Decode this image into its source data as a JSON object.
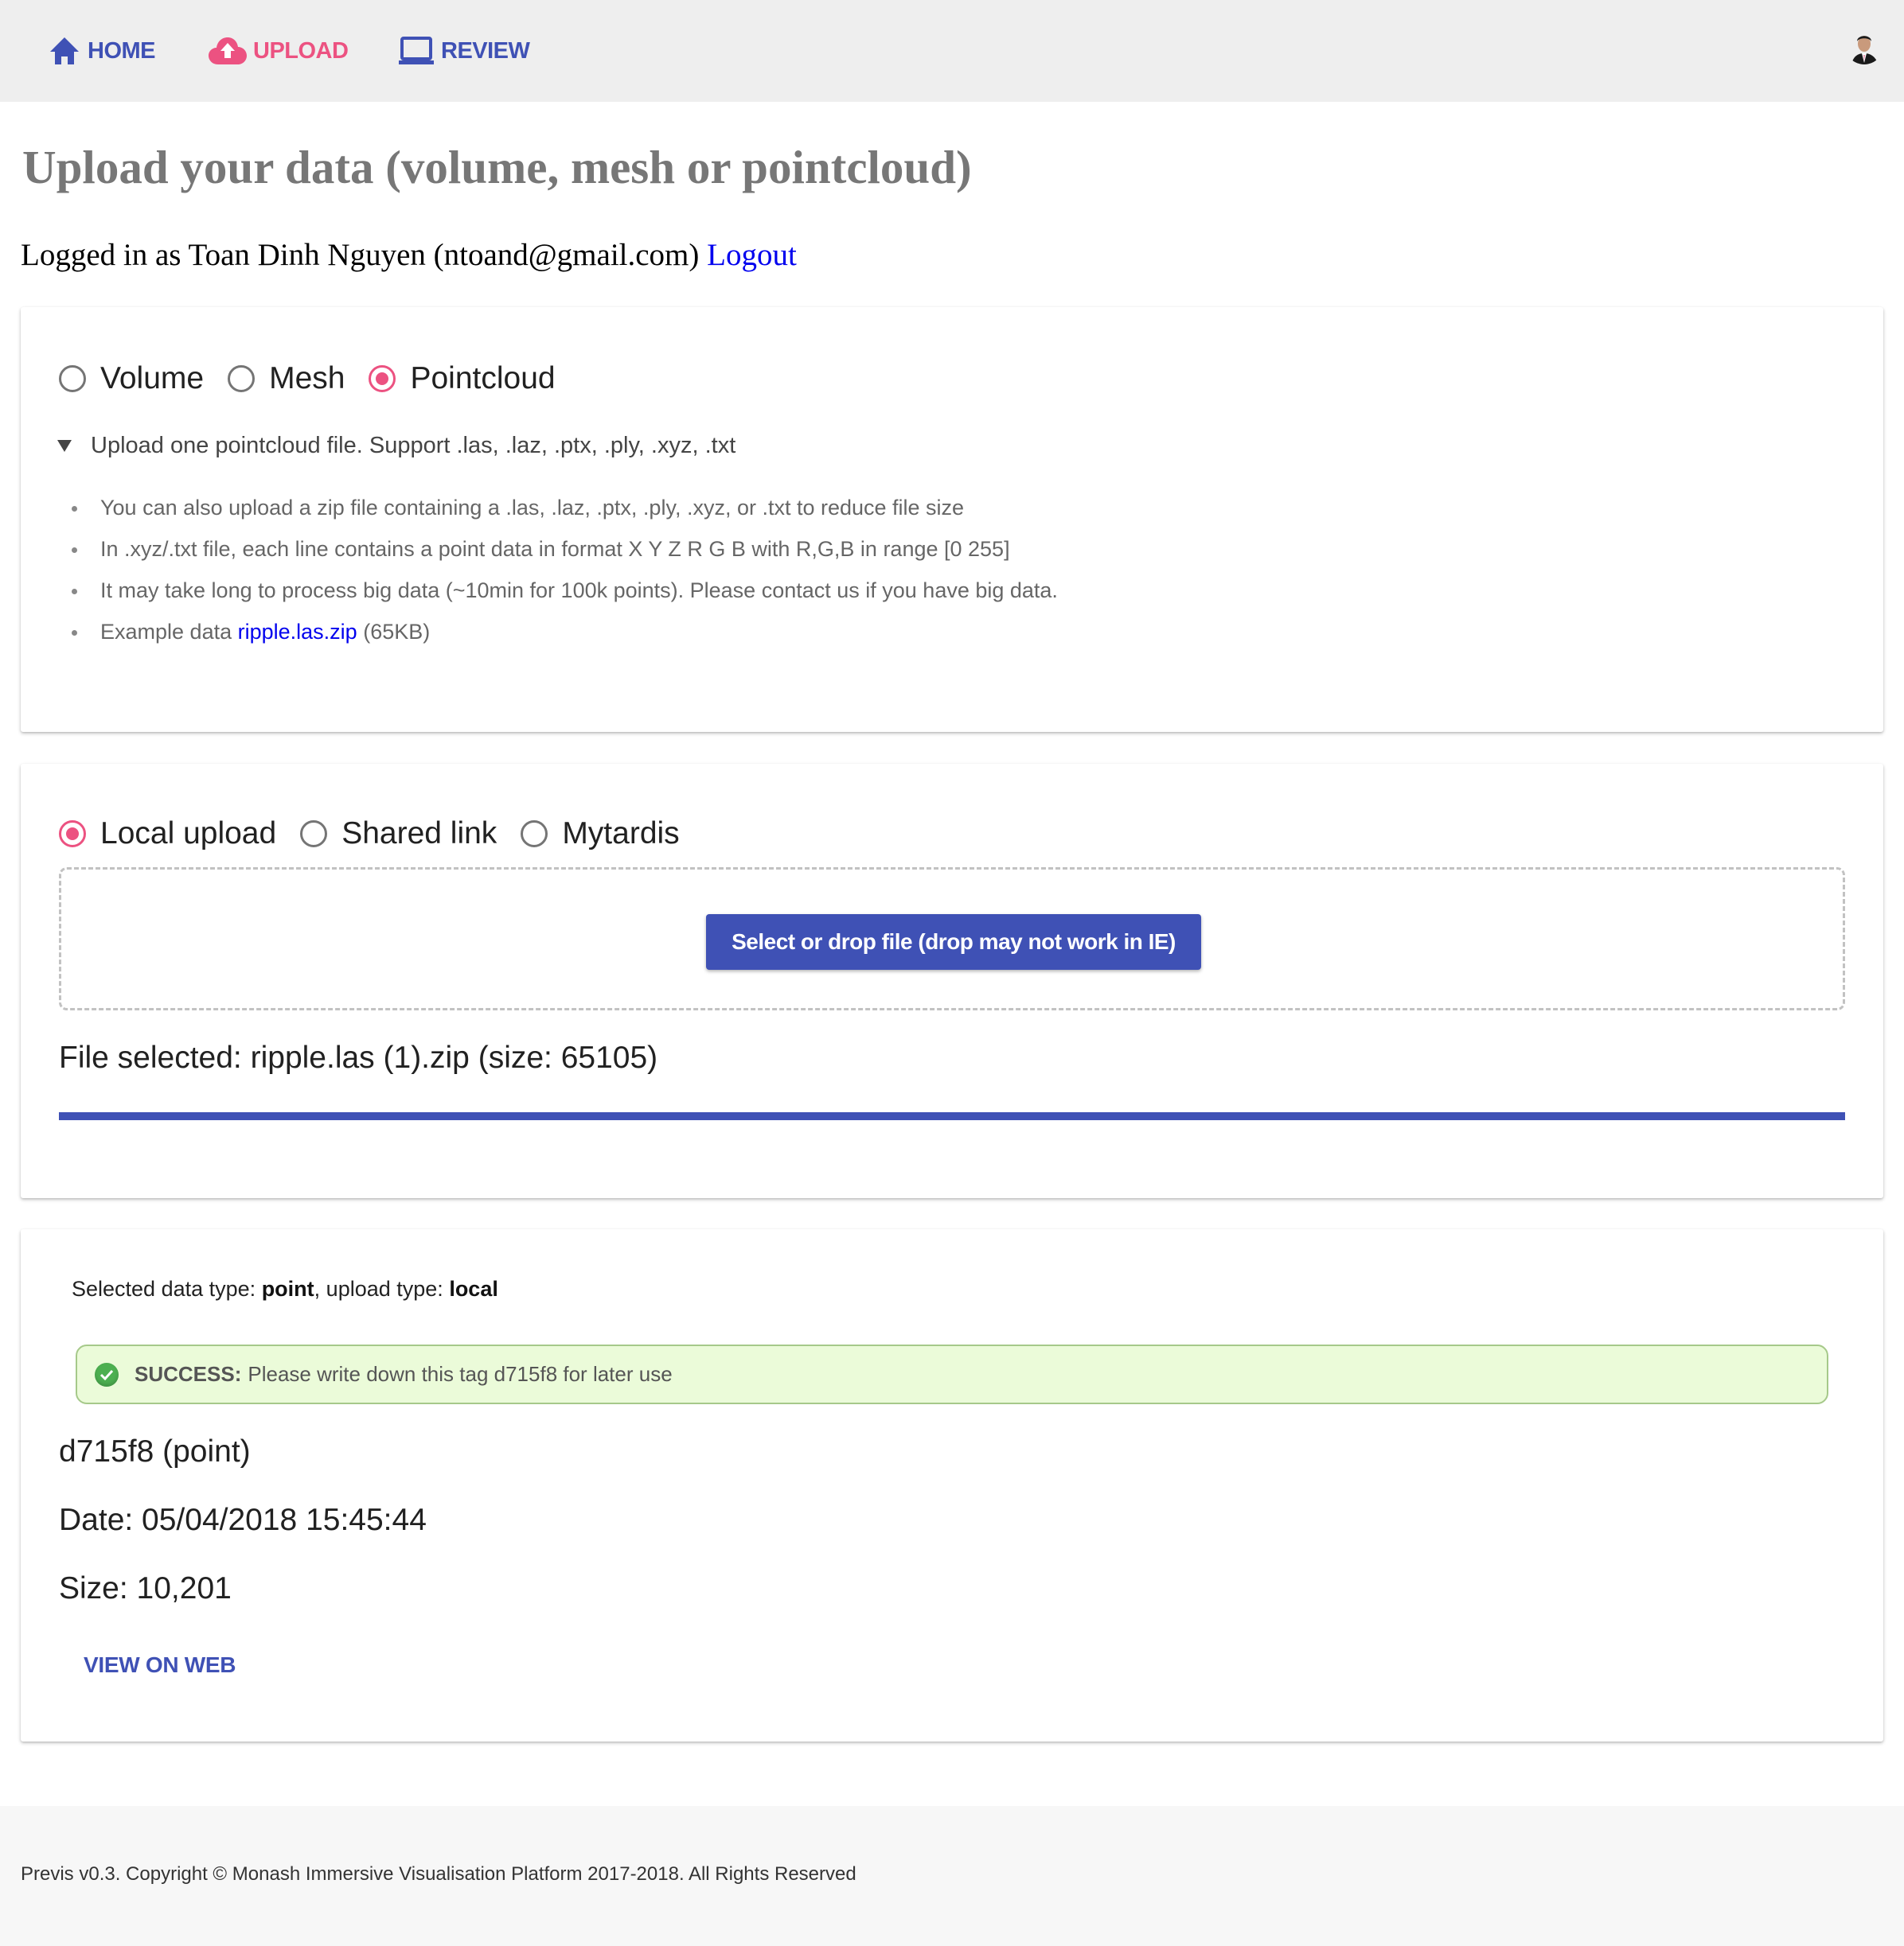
{
  "nav": {
    "items": [
      {
        "label": "HOME",
        "icon": "home-icon",
        "active": false
      },
      {
        "label": "UPLOAD",
        "icon": "cloud-upload-icon",
        "active": true
      },
      {
        "label": "REVIEW",
        "icon": "laptop-icon",
        "active": false
      }
    ],
    "avatar": "user-avatar"
  },
  "colors": {
    "primary": "#3f51b5",
    "accent": "#ec5281",
    "success_bg": "#ebfbd9",
    "success_border": "#a6c98a"
  },
  "page": {
    "title": "Upload your data (volume, mesh or pointcloud)",
    "login_prefix": "Logged in as Toan Dinh Nguyen (ntoand@gmail.com)",
    "logout_label": "Logout"
  },
  "data_type": {
    "options": [
      {
        "label": "Volume",
        "selected": false
      },
      {
        "label": "Mesh",
        "selected": false
      },
      {
        "label": "Pointcloud",
        "selected": true
      }
    ],
    "summary": "Upload one pointcloud file. Support .las, .laz, .ptx, .ply, .xyz, .txt",
    "bullets": [
      "You can also upload a zip file containing a .las, .laz, .ptx, .ply, .xyz, or .txt to reduce file size",
      "In .xyz/.txt file, each line contains a point data in format X Y Z R G B with R,G,B in range [0 255]",
      "It may take long to process big data (~10min for 100k points). Please contact us if you have big data."
    ],
    "example_prefix": "Example data",
    "example_link": "ripple.las.zip",
    "example_suffix": "(65KB)"
  },
  "upload": {
    "options": [
      {
        "label": "Local upload",
        "selected": true
      },
      {
        "label": "Shared link",
        "selected": false
      },
      {
        "label": "Mytardis",
        "selected": false
      }
    ],
    "select_button": "Select or drop file (drop may not work in IE)",
    "file_selected": "File selected: ripple.las (1).zip (size: 65105)",
    "progress_percent": 100
  },
  "result": {
    "selected_prefix": "Selected data type:",
    "selected_type": "point",
    "upload_prefix": ", upload type:",
    "upload_type": "local",
    "alert_title": "SUCCESS:",
    "alert_message": "Please write down this tag d715f8 for later use",
    "tag_line": "d715f8 (point)",
    "date_line": "Date: 05/04/2018 15:45:44",
    "size_line": "Size: 10,201",
    "view_button": "VIEW ON WEB"
  },
  "footer": {
    "text": "Previs v0.3. Copyright © Monash Immersive Visualisation Platform 2017-2018. All Rights Reserved"
  }
}
